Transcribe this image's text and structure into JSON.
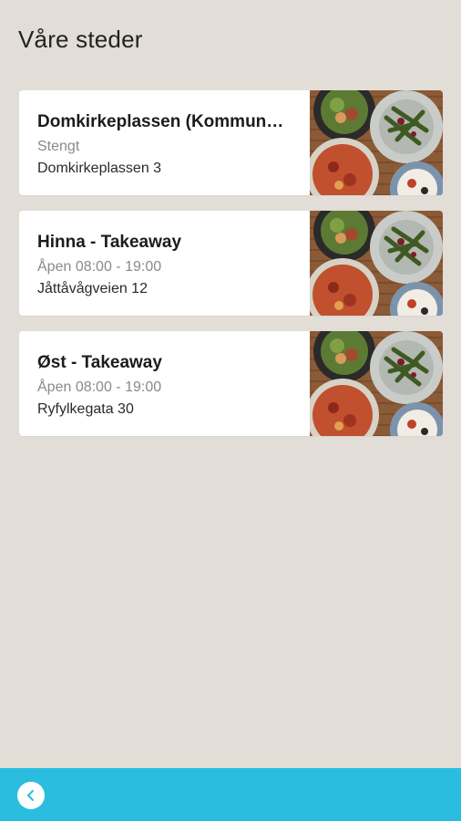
{
  "header": {
    "title": "Våre steder"
  },
  "locations": [
    {
      "name": "Domkirkeplassen (Kommunehuset)",
      "status": "Stengt",
      "address": "Domkirkeplassen 3",
      "image_icon": "food-photo"
    },
    {
      "name": "Hinna - Takeaway",
      "status": "Åpen 08:00 - 19:00",
      "address": "Jåttåvågveien 12",
      "image_icon": "food-photo"
    },
    {
      "name": "Øst - Takeaway",
      "status": "Åpen 08:00 - 19:00",
      "address": "Ryfylkegata 30",
      "image_icon": "food-photo"
    }
  ],
  "bottom_bar": {
    "color": "#2bbde0",
    "back_icon": "chevron-left-icon"
  },
  "colors": {
    "background": "#e2ddd6",
    "accent": "#2bbde0"
  }
}
